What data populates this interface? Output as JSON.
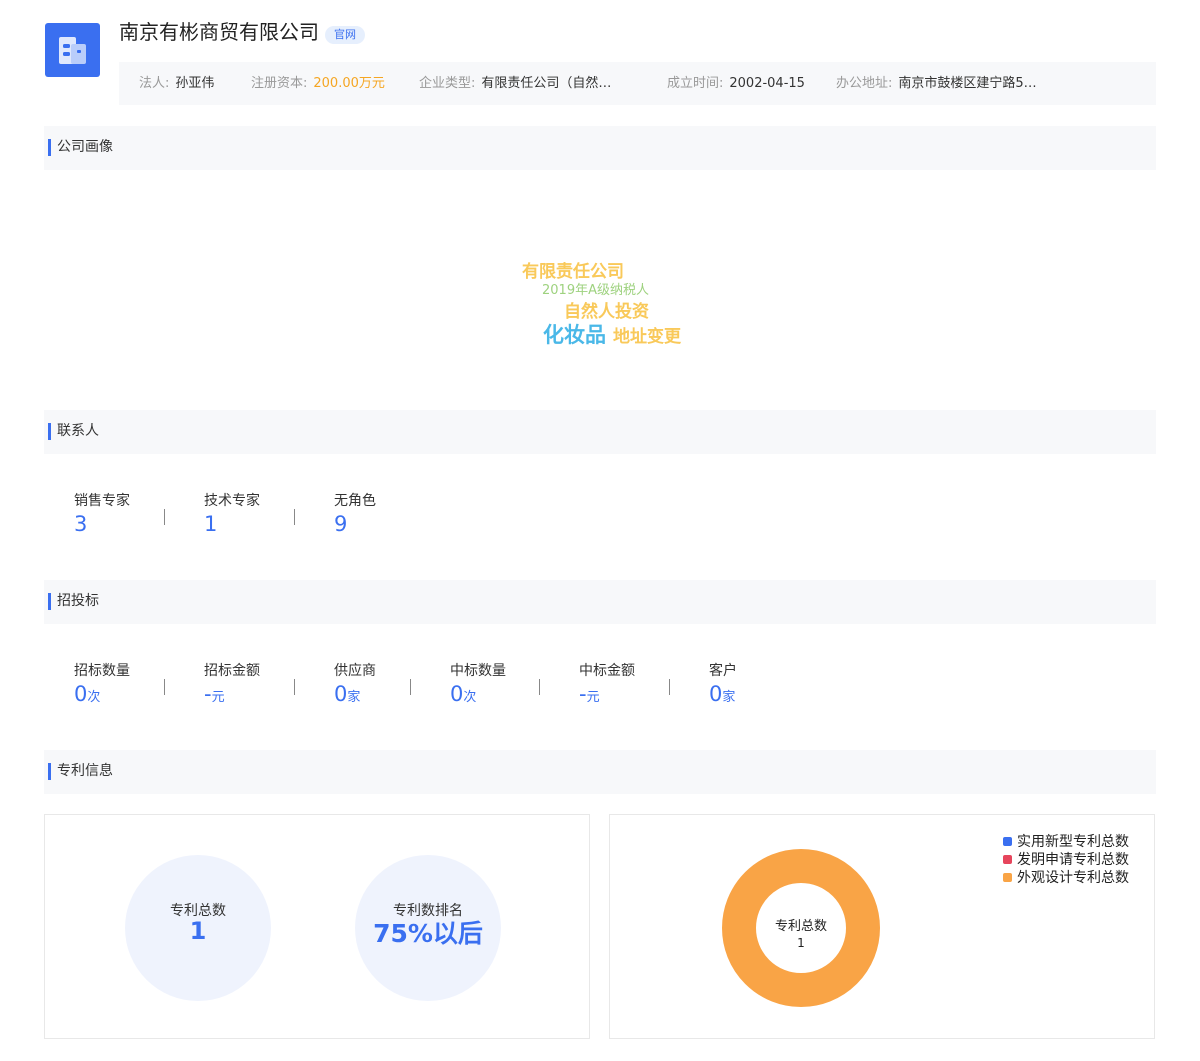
{
  "header": {
    "company_name": "南京有彬商贸有限公司",
    "official_tag": "官网",
    "logo_color": "#3a6ff0",
    "logo_icon": "building-icon"
  },
  "info": {
    "legal_label": "法人:",
    "legal_value": "孙亚伟",
    "capital_label": "注册资本:",
    "capital_value": "200.00万元",
    "type_label": "企业类型:",
    "type_value": "有限责任公司（自然…",
    "founded_label": "成立时间:",
    "founded_value": "2002-04-15",
    "address_label": "办公地址:",
    "address_value": "南京市鼓楼区建宁路5…"
  },
  "sections": {
    "portrait": "公司画像",
    "contacts": "联系人",
    "bidding": "招投标",
    "patents": "专利信息"
  },
  "word_cloud": [
    {
      "text": "有限责任公司",
      "color": "#f9c95a"
    },
    {
      "text": "2019年A级纳税人",
      "color": "#9ed27f"
    },
    {
      "text": "自然人投资",
      "color": "#f9c95a"
    },
    {
      "text": "化妆品",
      "color": "#4ab8e8"
    },
    {
      "text": "地址变更",
      "color": "#f9c95a"
    }
  ],
  "contacts": [
    {
      "label": "销售专家",
      "value": "3"
    },
    {
      "label": "技术专家",
      "value": "1"
    },
    {
      "label": "无角色",
      "value": "9"
    }
  ],
  "bidding": [
    {
      "label": "招标数量",
      "value": "0",
      "unit": "次"
    },
    {
      "label": "招标金额",
      "value": "-",
      "unit": "元"
    },
    {
      "label": "供应商",
      "value": "0",
      "unit": "家"
    },
    {
      "label": "中标数量",
      "value": "0",
      "unit": "次"
    },
    {
      "label": "中标金额",
      "value": "-",
      "unit": "元"
    },
    {
      "label": "客户",
      "value": "0",
      "unit": "家"
    }
  ],
  "patents": {
    "total_label": "专利总数",
    "total_value": "1",
    "rank_label": "专利数排名",
    "rank_value": "75%以后"
  },
  "chart_data": {
    "type": "pie",
    "center_label": "专利总数",
    "center_value": "1",
    "legend_position": "top-right",
    "series": [
      {
        "name": "实用新型专利总数",
        "value": 0,
        "color": "#3a6ff0"
      },
      {
        "name": "发明申请专利总数",
        "value": 0,
        "color": "#e6455c"
      },
      {
        "name": "外观设计专利总数",
        "value": 1,
        "color": "#f9a446"
      }
    ]
  }
}
